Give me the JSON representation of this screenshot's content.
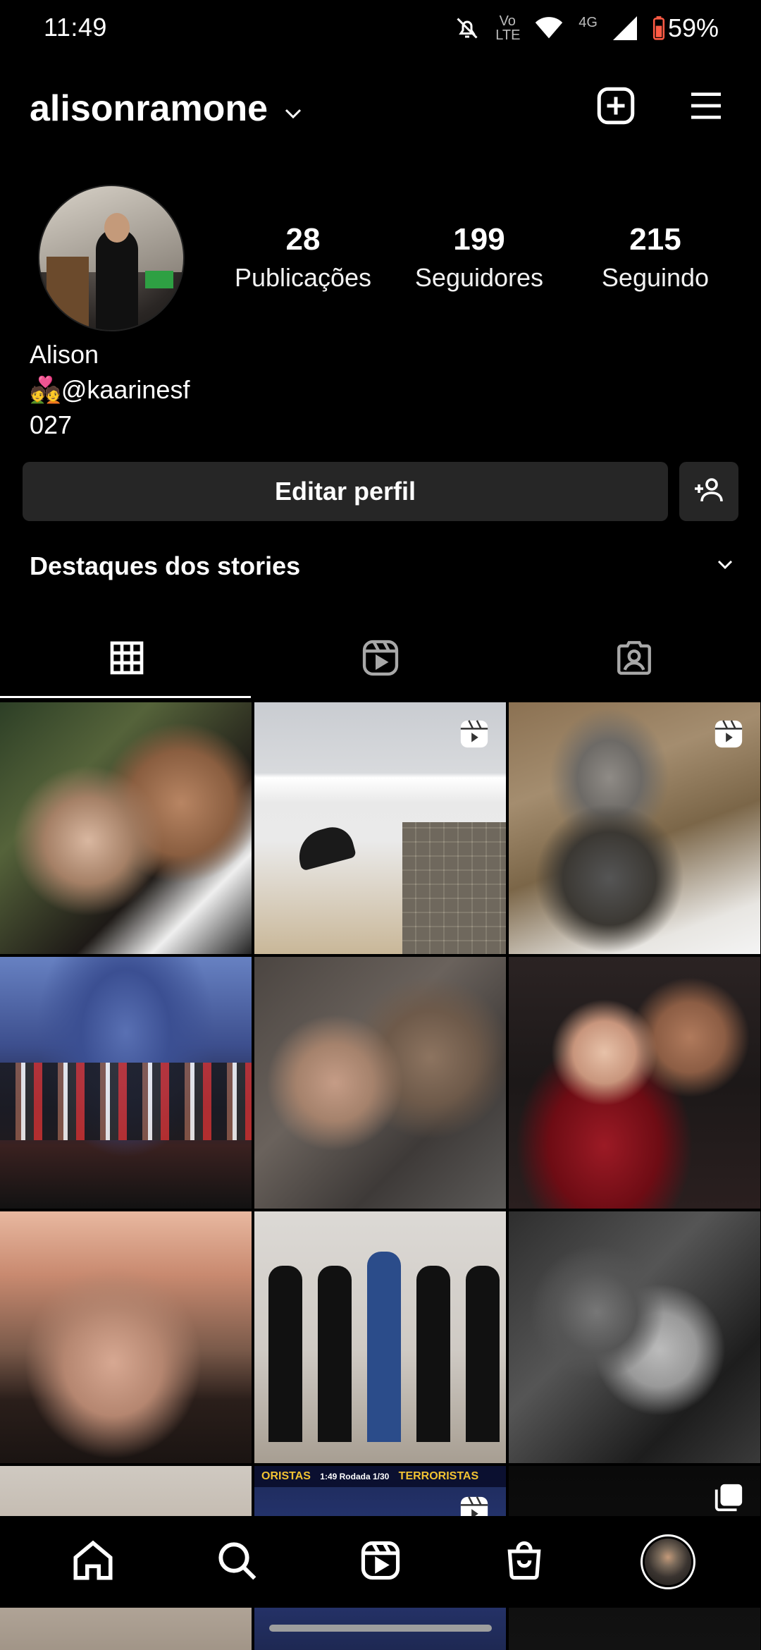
{
  "status_bar": {
    "time": "11:49",
    "network": "4G",
    "volte": "Vo LTE",
    "battery": "59%"
  },
  "header": {
    "username": "alisonramone"
  },
  "profile": {
    "stats": [
      {
        "value": "28",
        "label": "Publicações"
      },
      {
        "value": "199",
        "label": "Seguidores"
      },
      {
        "value": "215",
        "label": "Seguindo"
      }
    ],
    "name": "Alison",
    "bio_line1": "💑@kaarinesf",
    "bio_line2": "027"
  },
  "actions": {
    "edit_profile": "Editar perfil"
  },
  "highlights": {
    "title": "Destaques dos stories"
  },
  "tabs": [
    {
      "icon": "grid-icon",
      "active": true
    },
    {
      "icon": "reels-icon",
      "active": false
    },
    {
      "icon": "tagged-icon",
      "active": false
    }
  ],
  "posts": [
    {
      "type": "photo"
    },
    {
      "type": "reel"
    },
    {
      "type": "reel"
    },
    {
      "type": "photo"
    },
    {
      "type": "photo"
    },
    {
      "type": "photo"
    },
    {
      "type": "photo"
    },
    {
      "type": "photo"
    },
    {
      "type": "photo"
    },
    {
      "type": "photo"
    },
    {
      "type": "reel"
    },
    {
      "type": "carousel"
    }
  ],
  "post_texts": {
    "scoreboard_left": "ORISTAS",
    "scoreboard_mid": "1:49 Rodada 1/30",
    "scoreboard_right": "TERRORISTAS"
  },
  "bottom_nav": [
    {
      "icon": "home-icon"
    },
    {
      "icon": "search-icon"
    },
    {
      "icon": "reels-icon"
    },
    {
      "icon": "shop-icon"
    },
    {
      "icon": "profile-avatar"
    }
  ],
  "colors": {
    "background": "#000000",
    "button": "#262626",
    "text": "#ffffff"
  }
}
